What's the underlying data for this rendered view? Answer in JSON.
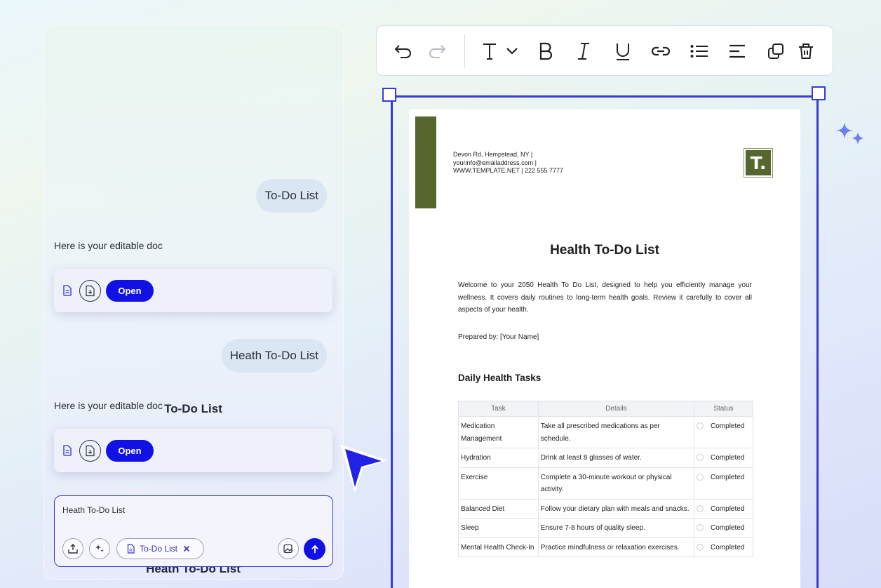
{
  "chat": {
    "messages": [
      {
        "role": "user",
        "text": "To-Do List"
      },
      {
        "role": "assistant",
        "text": "Here is your editable doc",
        "doc_title": "To-Do List",
        "open_label": "Open"
      },
      {
        "role": "user",
        "text": "Heath To-Do List"
      },
      {
        "role": "assistant",
        "text": "Here is your editable doc",
        "doc_title": "Heath To-Do List",
        "open_label": "Open"
      }
    ],
    "composer": {
      "value": "Heath To-Do List",
      "chip_label": "To-Do List"
    }
  },
  "toolbar": {
    "tools": [
      "undo-icon",
      "redo-icon",
      "text-style-icon",
      "bold-icon",
      "italic-icon",
      "underline-icon",
      "link-icon",
      "bullet-list-icon",
      "align-left-icon",
      "duplicate-icon",
      "delete-icon"
    ]
  },
  "document": {
    "address_line1": "Devon Rd, Hempstead, NY |",
    "address_line2": "yourinfo@emailaddress.com |",
    "address_line3": "WWW.TEMPLATE.NET | 222 555 7777",
    "logo_text": "T.",
    "title": "Health To-Do List",
    "intro": "Welcome to your 2050 Health To Do List, designed to help you efficiently manage your wellness. It covers daily routines to long-term health goals. Review it carefully to cover all aspects of your health.",
    "prepared_by": "Prepared by: [Your Name]",
    "section_title": "Daily Health Tasks",
    "table": {
      "headers": [
        "Task",
        "Details",
        "Status"
      ],
      "rows": [
        {
          "task": "Medication Management",
          "details": "Take all prescribed medications as per schedule.",
          "status": "Completed"
        },
        {
          "task": "Hydration",
          "details": "Drink at least 8 glasses of water.",
          "status": "Completed"
        },
        {
          "task": "Exercise",
          "details": "Complete a 30-minute workout or physical activity.",
          "status": "Completed"
        },
        {
          "task": "Balanced Diet",
          "details": "Follow your dietary plan with meals and snacks.",
          "status": "Completed"
        },
        {
          "task": "Sleep",
          "details": "Ensure 7-8 hours of quality sleep.",
          "status": "Completed"
        },
        {
          "task": "Mental Health Check-In",
          "details": "Practice mindfulness or relaxation exercises.",
          "status": "Completed"
        }
      ]
    }
  },
  "colors": {
    "accent": "#1111e6",
    "selection": "#3a3ad6",
    "brand_green": "#56662e"
  }
}
